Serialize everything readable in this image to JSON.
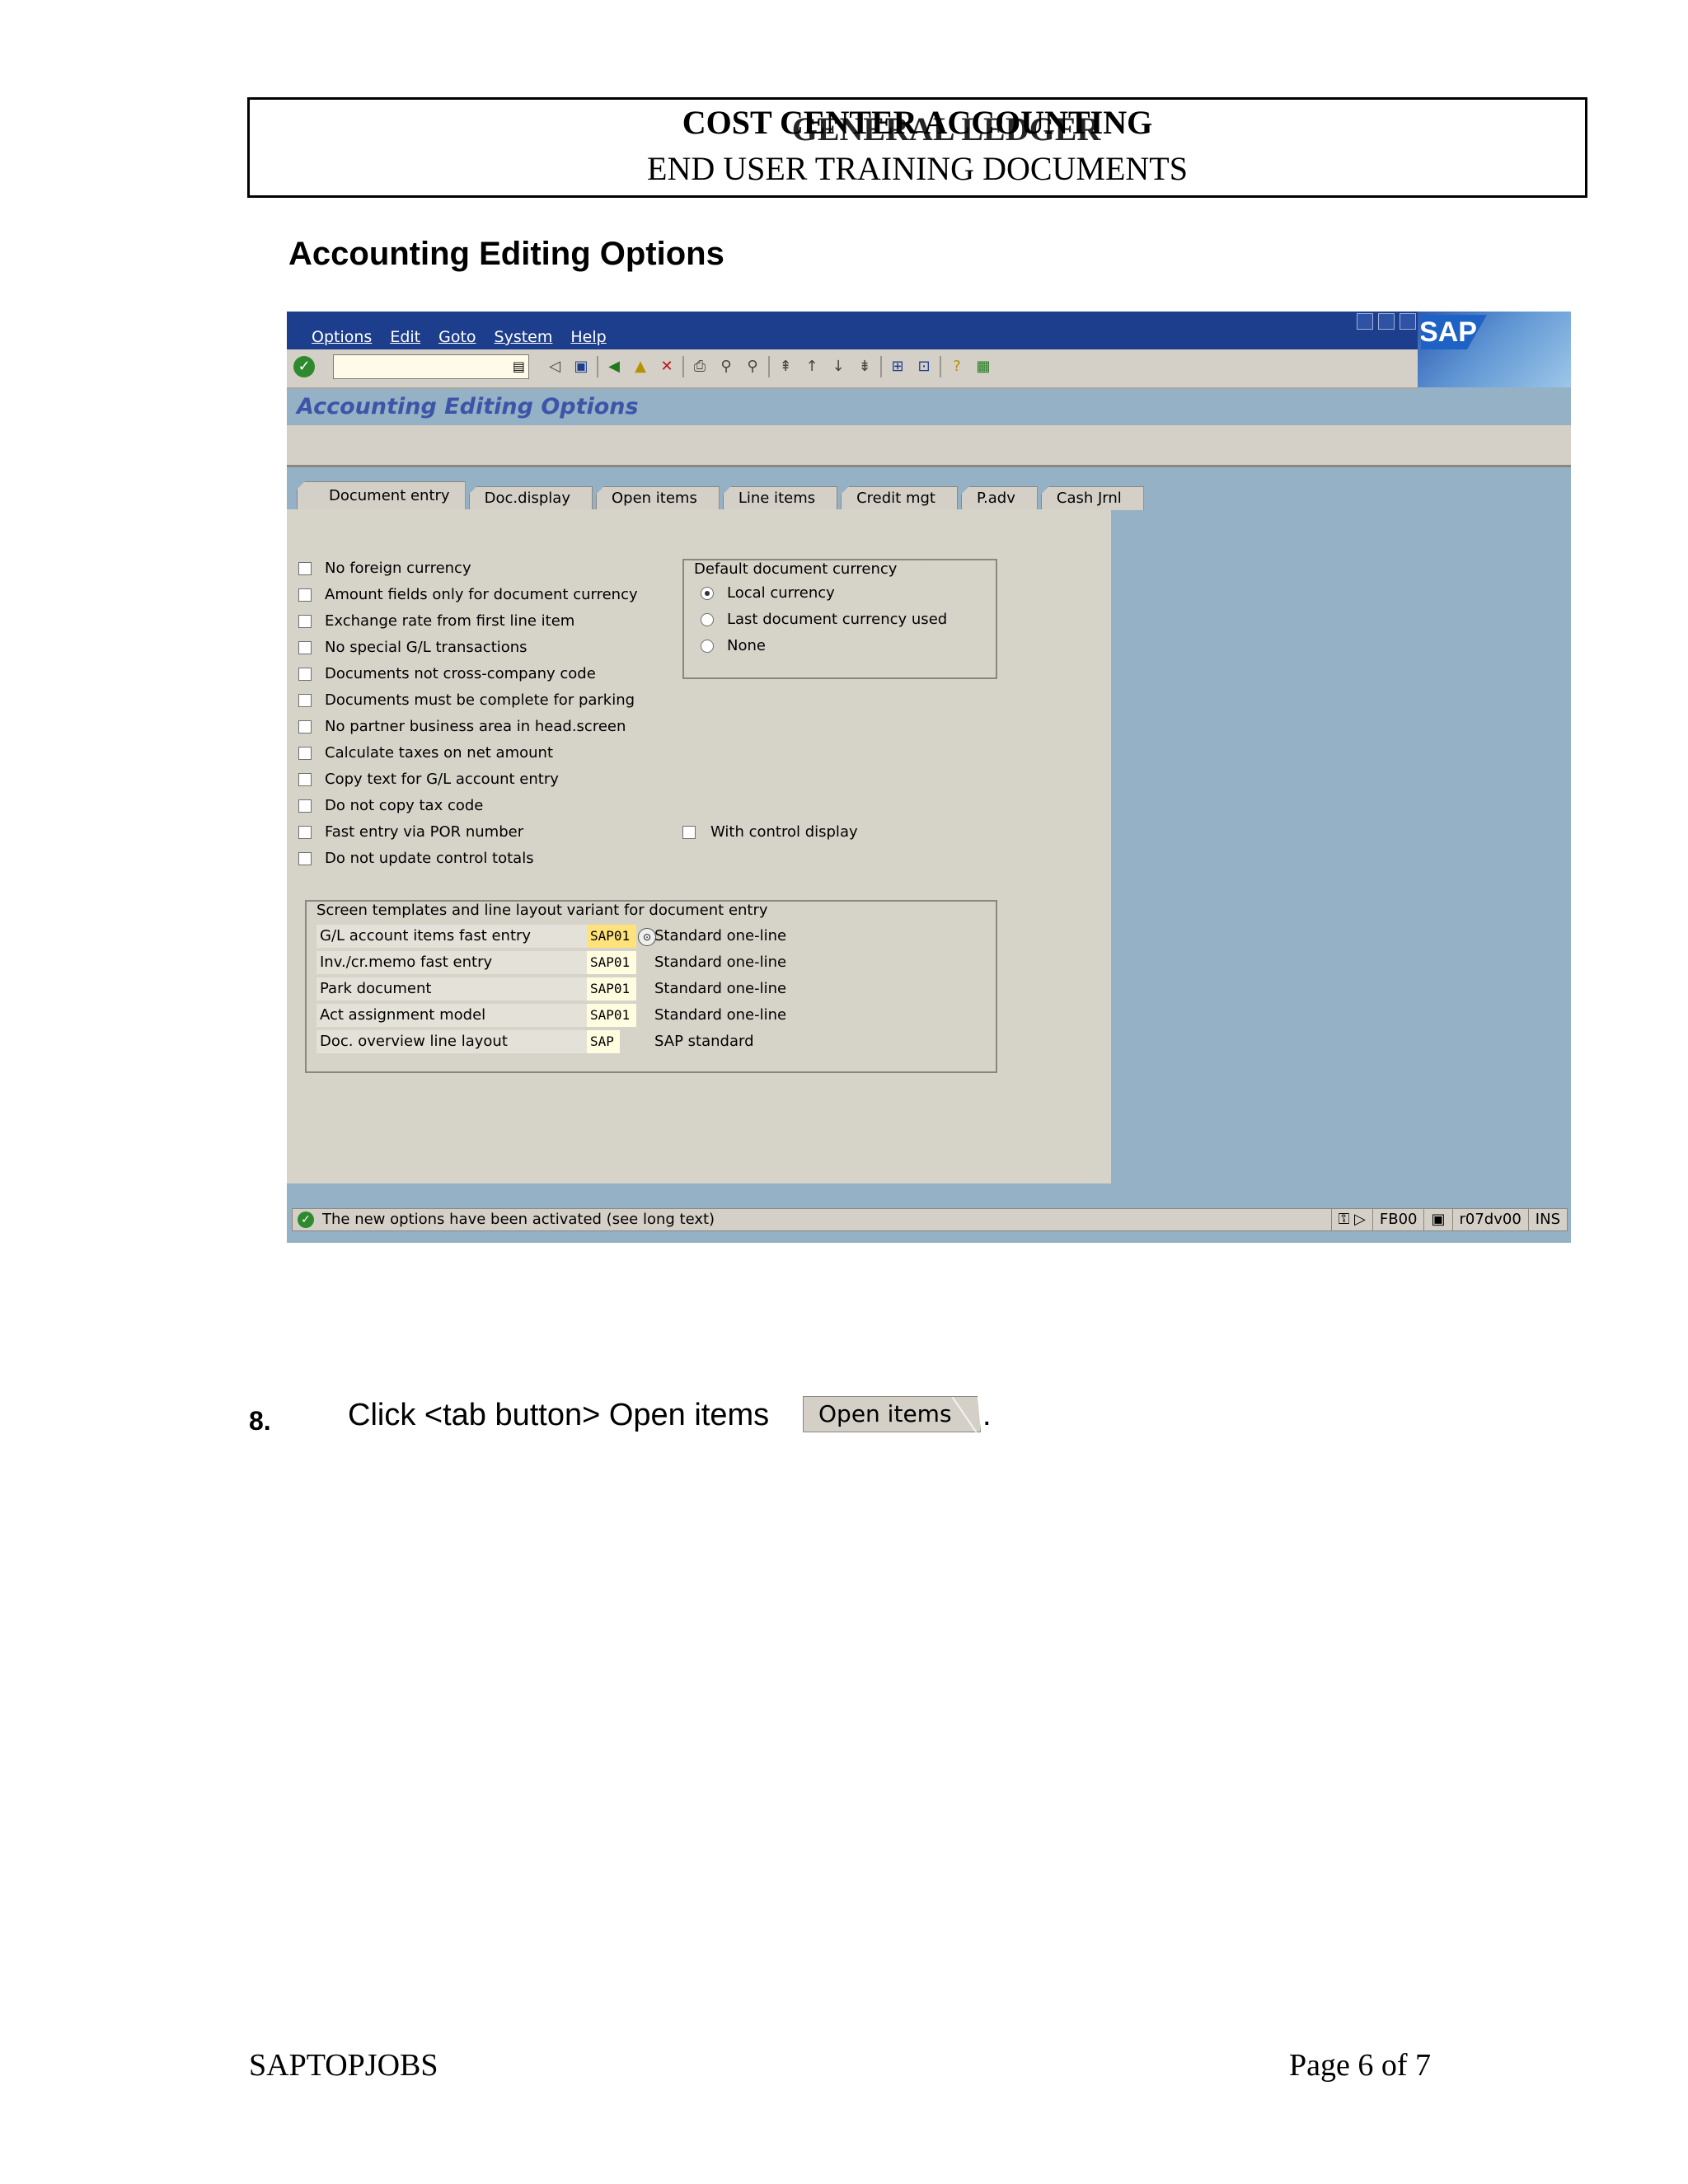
{
  "header": {
    "line1a": "COST CENTER ACCOUNTING",
    "line1b": "GENERAL LEDGER",
    "line2": "END USER TRAINING DOCUMENTS"
  },
  "section_title": "Accounting Editing Options",
  "sap": {
    "menu": [
      "Options",
      "Edit",
      "Goto",
      "System",
      "Help"
    ],
    "logo": "SAP",
    "screen_title": "Accounting Editing Options",
    "tabs": [
      "Document entry",
      "Doc.display",
      "Open items",
      "Line items",
      "Credit mgt",
      "P.adv",
      "Cash Jrnl"
    ],
    "active_tab": "Document entry",
    "checkboxes": [
      "No foreign currency",
      "Amount fields only for document currency",
      "Exchange rate from first line item",
      "No special G/L transactions",
      "Documents not cross-company code",
      "Documents must be complete for parking",
      "No partner business area in head.screen",
      "Calculate taxes on net amount",
      "Copy text for G/L account entry",
      "Do not copy tax code",
      "Fast entry via POR number",
      "Do not update control totals"
    ],
    "with_control_display": "With control display",
    "currency_group": {
      "title": "Default document currency",
      "options": [
        "Local currency",
        "Last document currency used",
        "None"
      ],
      "selected": "Local currency"
    },
    "templates_group": {
      "title": "Screen templates and line layout variant for document entry",
      "rows": [
        {
          "label": "G/L account items fast entry",
          "value": "SAP01",
          "desc": "Standard one-line"
        },
        {
          "label": "Inv./cr.memo fast entry",
          "value": "SAP01",
          "desc": "Standard one-line"
        },
        {
          "label": "Park document",
          "value": "SAP01",
          "desc": "Standard one-line"
        },
        {
          "label": "Act assignment model",
          "value": "SAP01",
          "desc": "Standard one-line"
        },
        {
          "label": "Doc. overview line layout",
          "value": "SAP",
          "desc": "SAP standard"
        }
      ]
    },
    "status": {
      "message": "The new options have been activated (see long text)",
      "tcode": "FB00",
      "server": "r07dv00",
      "mode": "INS"
    }
  },
  "step": {
    "number": "8.",
    "text": "Click <tab button> Open items",
    "button_label": "Open items",
    "end": "."
  },
  "footer": {
    "left": "SAPTOPJOBS",
    "right": "Page 6 of 7"
  }
}
